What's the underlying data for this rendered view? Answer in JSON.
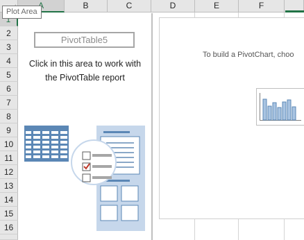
{
  "tooltip": {
    "label": "Plot Area"
  },
  "columns": [
    "A",
    "B",
    "C",
    "D",
    "E",
    "F"
  ],
  "rows": [
    "1",
    "2",
    "3",
    "4",
    "5",
    "6",
    "7",
    "8",
    "9",
    "10",
    "11",
    "12",
    "13",
    "14",
    "15",
    "16"
  ],
  "pivot_table": {
    "name": "PivotTable5",
    "message_line1": "Click in this area to work with",
    "message_line2": "the PivotTable report"
  },
  "pivot_chart": {
    "message": "To build a PivotChart, choo"
  },
  "colors": {
    "accent_green": "#217346",
    "illustration_blue": "#5b87b5",
    "illustration_light": "#c6d7eb",
    "check_red": "#c0392b"
  }
}
